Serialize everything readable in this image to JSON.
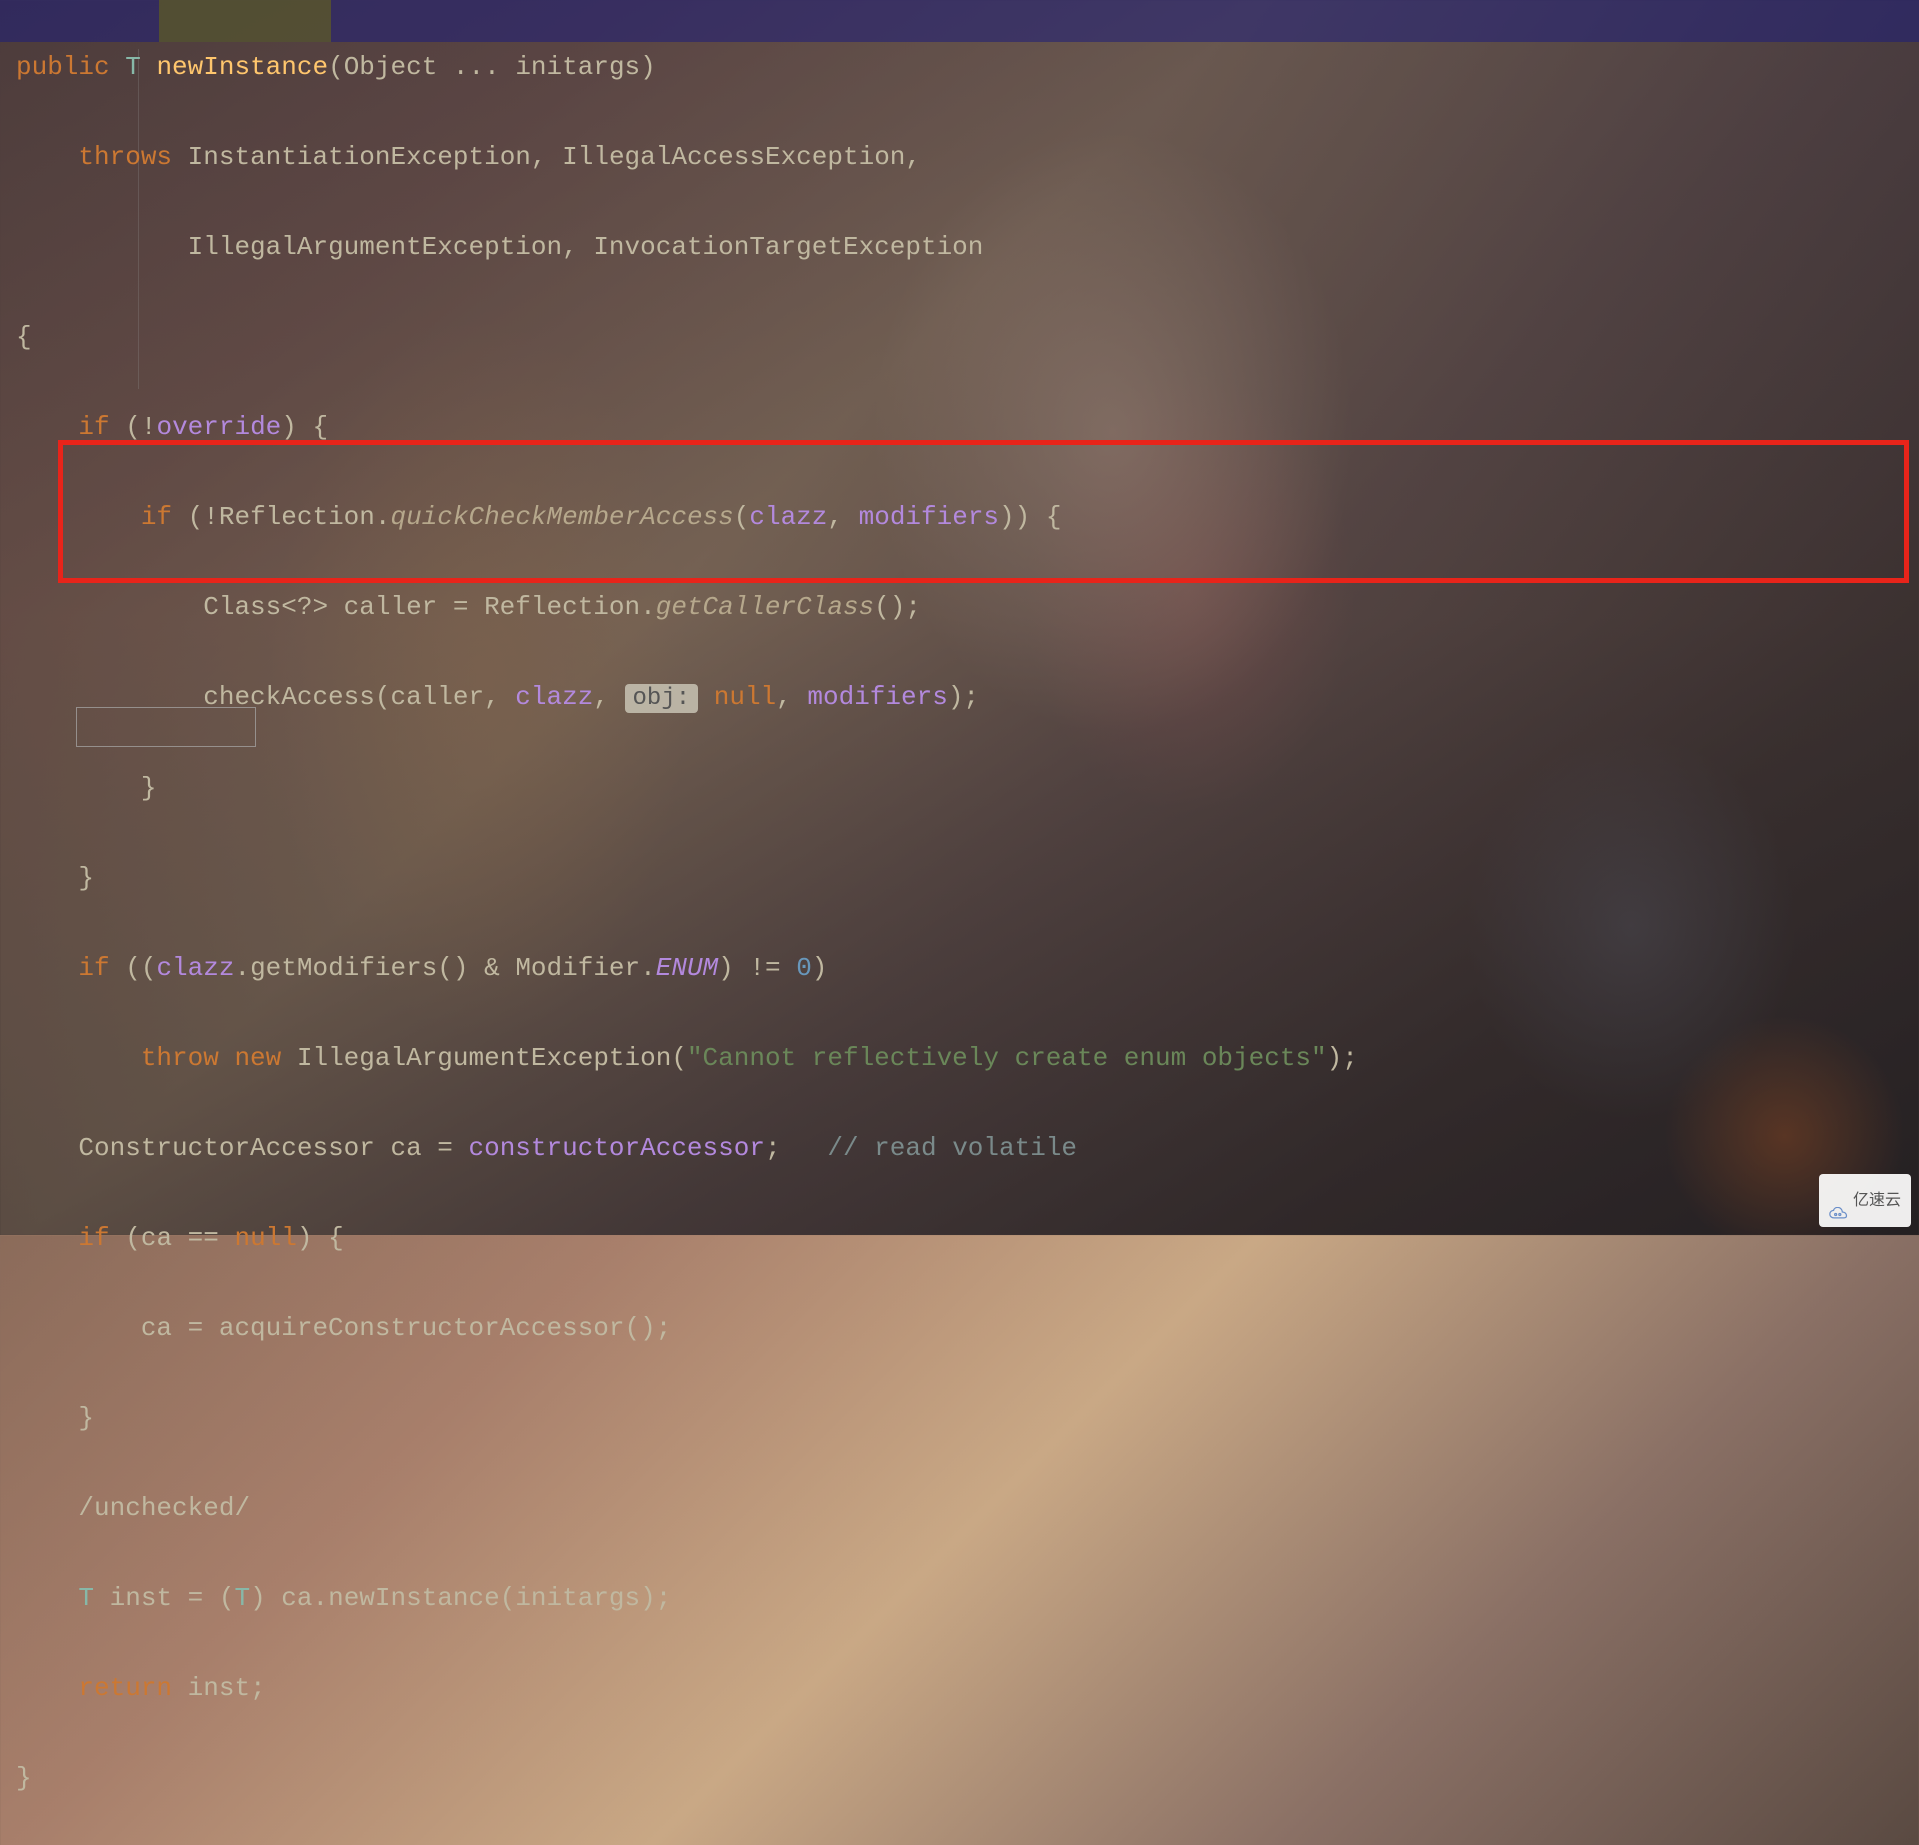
{
  "code": {
    "l1_public": "public",
    "l1_T": "T",
    "l1_method": "newInstance",
    "l1_sig": "(Object ... initargs)",
    "l2_throws": "throws",
    "l2_ex1": "InstantiationException",
    "l2_ex2": "IllegalAccessException",
    "l3_ex3": "IllegalArgumentException",
    "l3_ex4": "InvocationTargetException",
    "l4_brace": "{",
    "l5_if": "if",
    "l5_neg": "(!",
    "l5_override": "override",
    "l5_end": ") {",
    "l6_if": "if",
    "l6_neg": "(!Reflection.",
    "l6_method": "quickCheckMemberAccess",
    "l6_open": "(",
    "l6_clazz": "clazz",
    "l6_comma": ", ",
    "l6_modifiers": "modifiers",
    "l6_end": ")) {",
    "l7_pre": "Class<?> caller = Reflection.",
    "l7_method": "getCallerClass",
    "l7_end": "();",
    "l8_check": "checkAccess(caller, ",
    "l8_clazz": "clazz",
    "l8_comma": ", ",
    "l8_hint": "obj:",
    "l8_null": "null",
    "l8_comma2": ", ",
    "l8_modifiers": "modifiers",
    "l8_end": ");",
    "l9_brace": "}",
    "l10_brace": "}",
    "l11_if": "if",
    "l11_open": " ((",
    "l11_clazz": "clazz",
    "l11_getmod": ".getModifiers() & Modifier.",
    "l11_enum": "ENUM",
    "l11_end": ") != ",
    "l11_zero": "0",
    "l11_close": ")",
    "l12_throw": "throw",
    "l12_new": "new",
    "l12_class": " IllegalArgumentException(",
    "l12_str": "\"Cannot reflectively create enum objects\"",
    "l12_end": ");",
    "l13_pre": "ConstructorAccessor ca = ",
    "l13_field": "constructorAccessor",
    "l13_semi": ";   ",
    "l13_comment": "// read volatile",
    "l14_if": "if",
    "l14_cond_open": " (ca == ",
    "l14_null": "null",
    "l14_cond_close": ") {",
    "l15": "ca = acquireConstructorAccessor();",
    "l16_brace": "}",
    "l17": "/unchecked/",
    "l18_T": "T",
    "l18_inst": " inst = (",
    "l18_T2": "T",
    "l18_rest": ") ca.newInstance(initargs);",
    "l19_return": "return",
    "l19_inst": " inst;",
    "l20_brace": "}"
  },
  "watermark": {
    "text": "亿速云"
  }
}
